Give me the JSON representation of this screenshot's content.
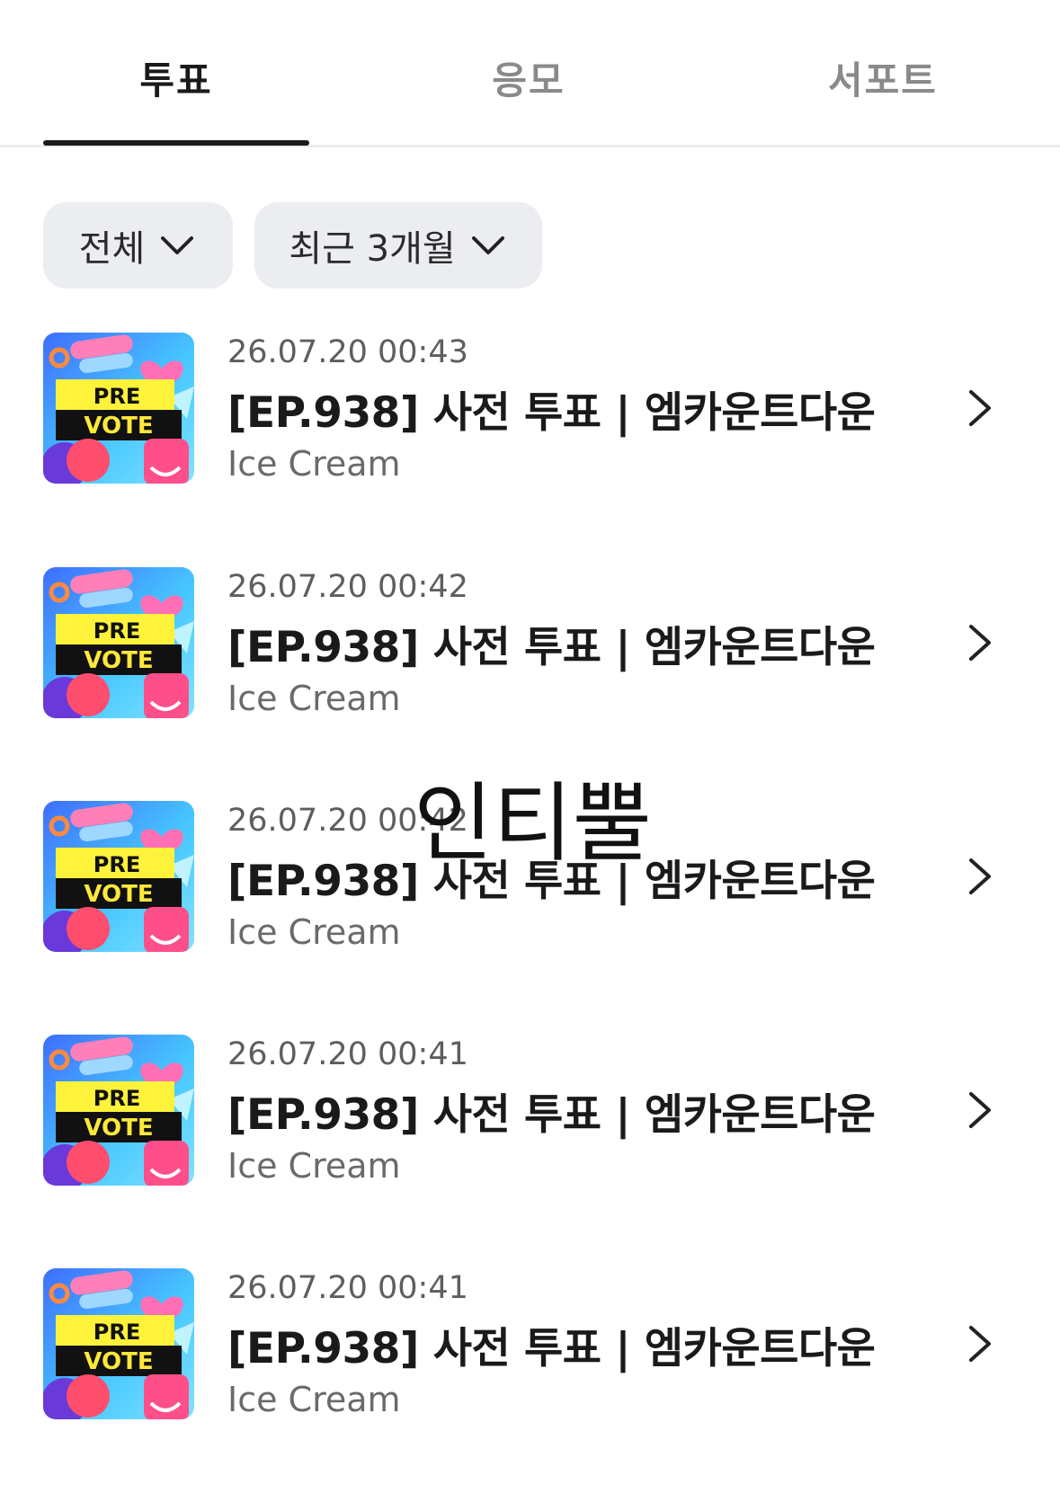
{
  "tabs": [
    {
      "label": "투표",
      "active": true
    },
    {
      "label": "응모",
      "active": false
    },
    {
      "label": "서포트",
      "active": false
    }
  ],
  "filters": [
    {
      "label": "전체"
    },
    {
      "label": "최근 3개월"
    }
  ],
  "thumbnail": {
    "line1": "PRE",
    "line2": "VOTE"
  },
  "items": [
    {
      "date": "26.07.20 00:43",
      "title": "[EP.938] 사전 투표 | 엠카운트다운",
      "subtitle": "Ice Cream"
    },
    {
      "date": "26.07.20 00:42",
      "title": "[EP.938] 사전 투표 | 엠카운트다운",
      "subtitle": "Ice Cream"
    },
    {
      "date": "26.07.20 00:42",
      "title": "[EP.938] 사전 투표 | 엠카운트다운",
      "subtitle": "Ice Cream"
    },
    {
      "date": "26.07.20 00:41",
      "title": "[EP.938] 사전 투표 | 엠카운트다운",
      "subtitle": "Ice Cream"
    },
    {
      "date": "26.07.20 00:41",
      "title": "[EP.938] 사전 투표 | 엠카운트다운",
      "subtitle": "Ice Cream"
    }
  ],
  "overlay_text": "인티뿔",
  "icons": {
    "filter_chevron": "chevron-down-icon",
    "row_chevron": "chevron-right-icon"
  }
}
